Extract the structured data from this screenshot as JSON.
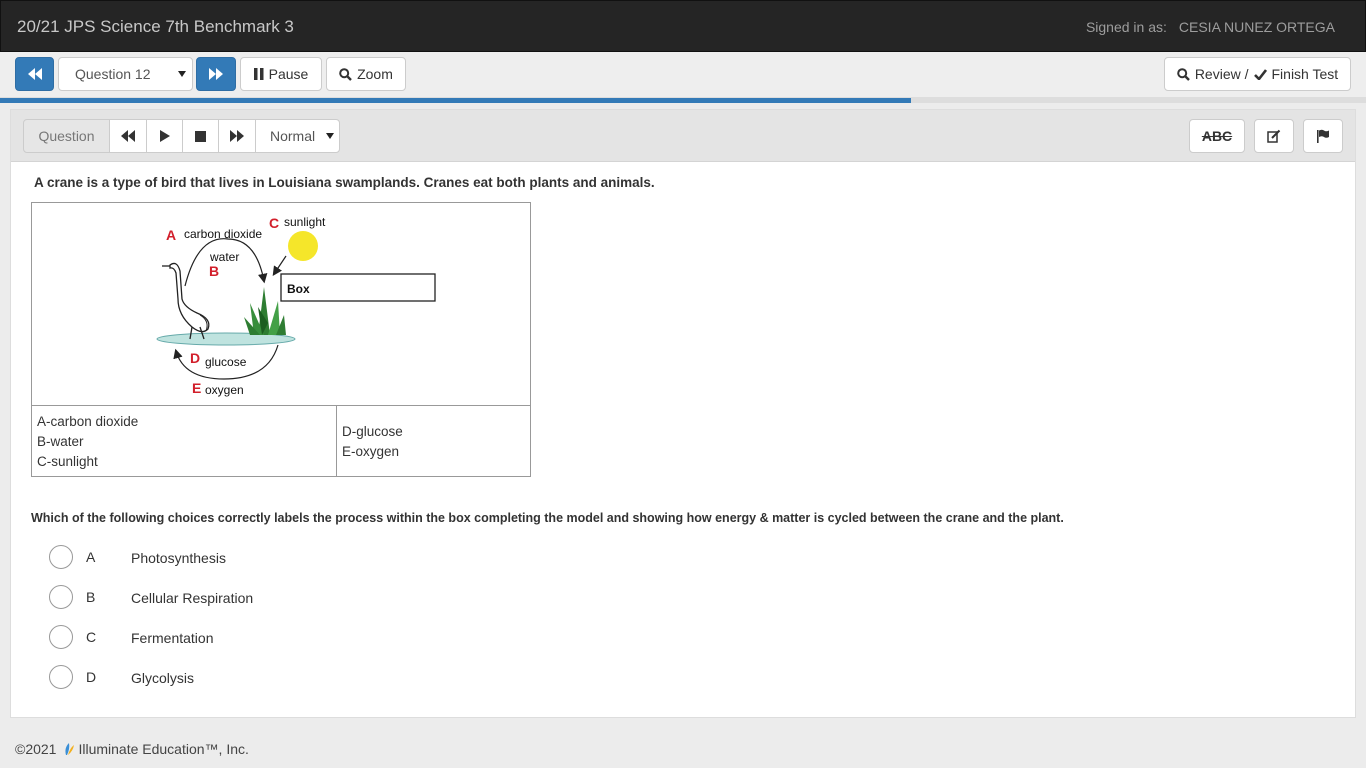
{
  "header": {
    "title": "20/21 JPS Science 7th Benchmark 3",
    "signed_in_label": "Signed in as:",
    "user_name": "CESIA NUNEZ ORTEGA"
  },
  "toolbar": {
    "question_select": "Question 12",
    "pause_label": "Pause",
    "zoom_label": "Zoom",
    "review_label": "Review /",
    "finish_label": "Finish Test"
  },
  "progress": {
    "percent": 66.7
  },
  "controls": {
    "question_label": "Question",
    "speed_select": "Normal",
    "spellcheck_label": "ABC"
  },
  "question": {
    "intro": "A crane is a type of bird that lives in Louisiana swamplands. Cranes eat both plants and animals.",
    "diagram": {
      "labels": {
        "a_letter": "A",
        "a_text": "carbon dioxide",
        "b_letter": "B",
        "b_text": "water",
        "c_letter": "C",
        "c_text": "sunlight",
        "d_letter": "D",
        "d_text": "glucose",
        "e_letter": "E",
        "e_text": "oxygen",
        "box_text": "Box"
      }
    },
    "key_left": [
      "A-carbon dioxide",
      "B-water",
      "C-sunlight"
    ],
    "key_right": [
      "D-glucose",
      "E-oxygen"
    ],
    "prompt": "Which of the following choices correctly labels the process within the box completing the model and showing how energy & matter is cycled between the crane and the plant.",
    "choices": [
      {
        "letter": "A",
        "text": "Photosynthesis"
      },
      {
        "letter": "B",
        "text": "Cellular Respiration"
      },
      {
        "letter": "C",
        "text": "Fermentation"
      },
      {
        "letter": "D",
        "text": "Glycolysis"
      }
    ]
  },
  "footer": {
    "copyright": "©2021",
    "company": "Illuminate Education™, Inc."
  },
  "colors": {
    "accent": "#337ab7",
    "topbar": "#252525",
    "diagram_red": "#d21f2b",
    "sun": "#f5e62a"
  }
}
